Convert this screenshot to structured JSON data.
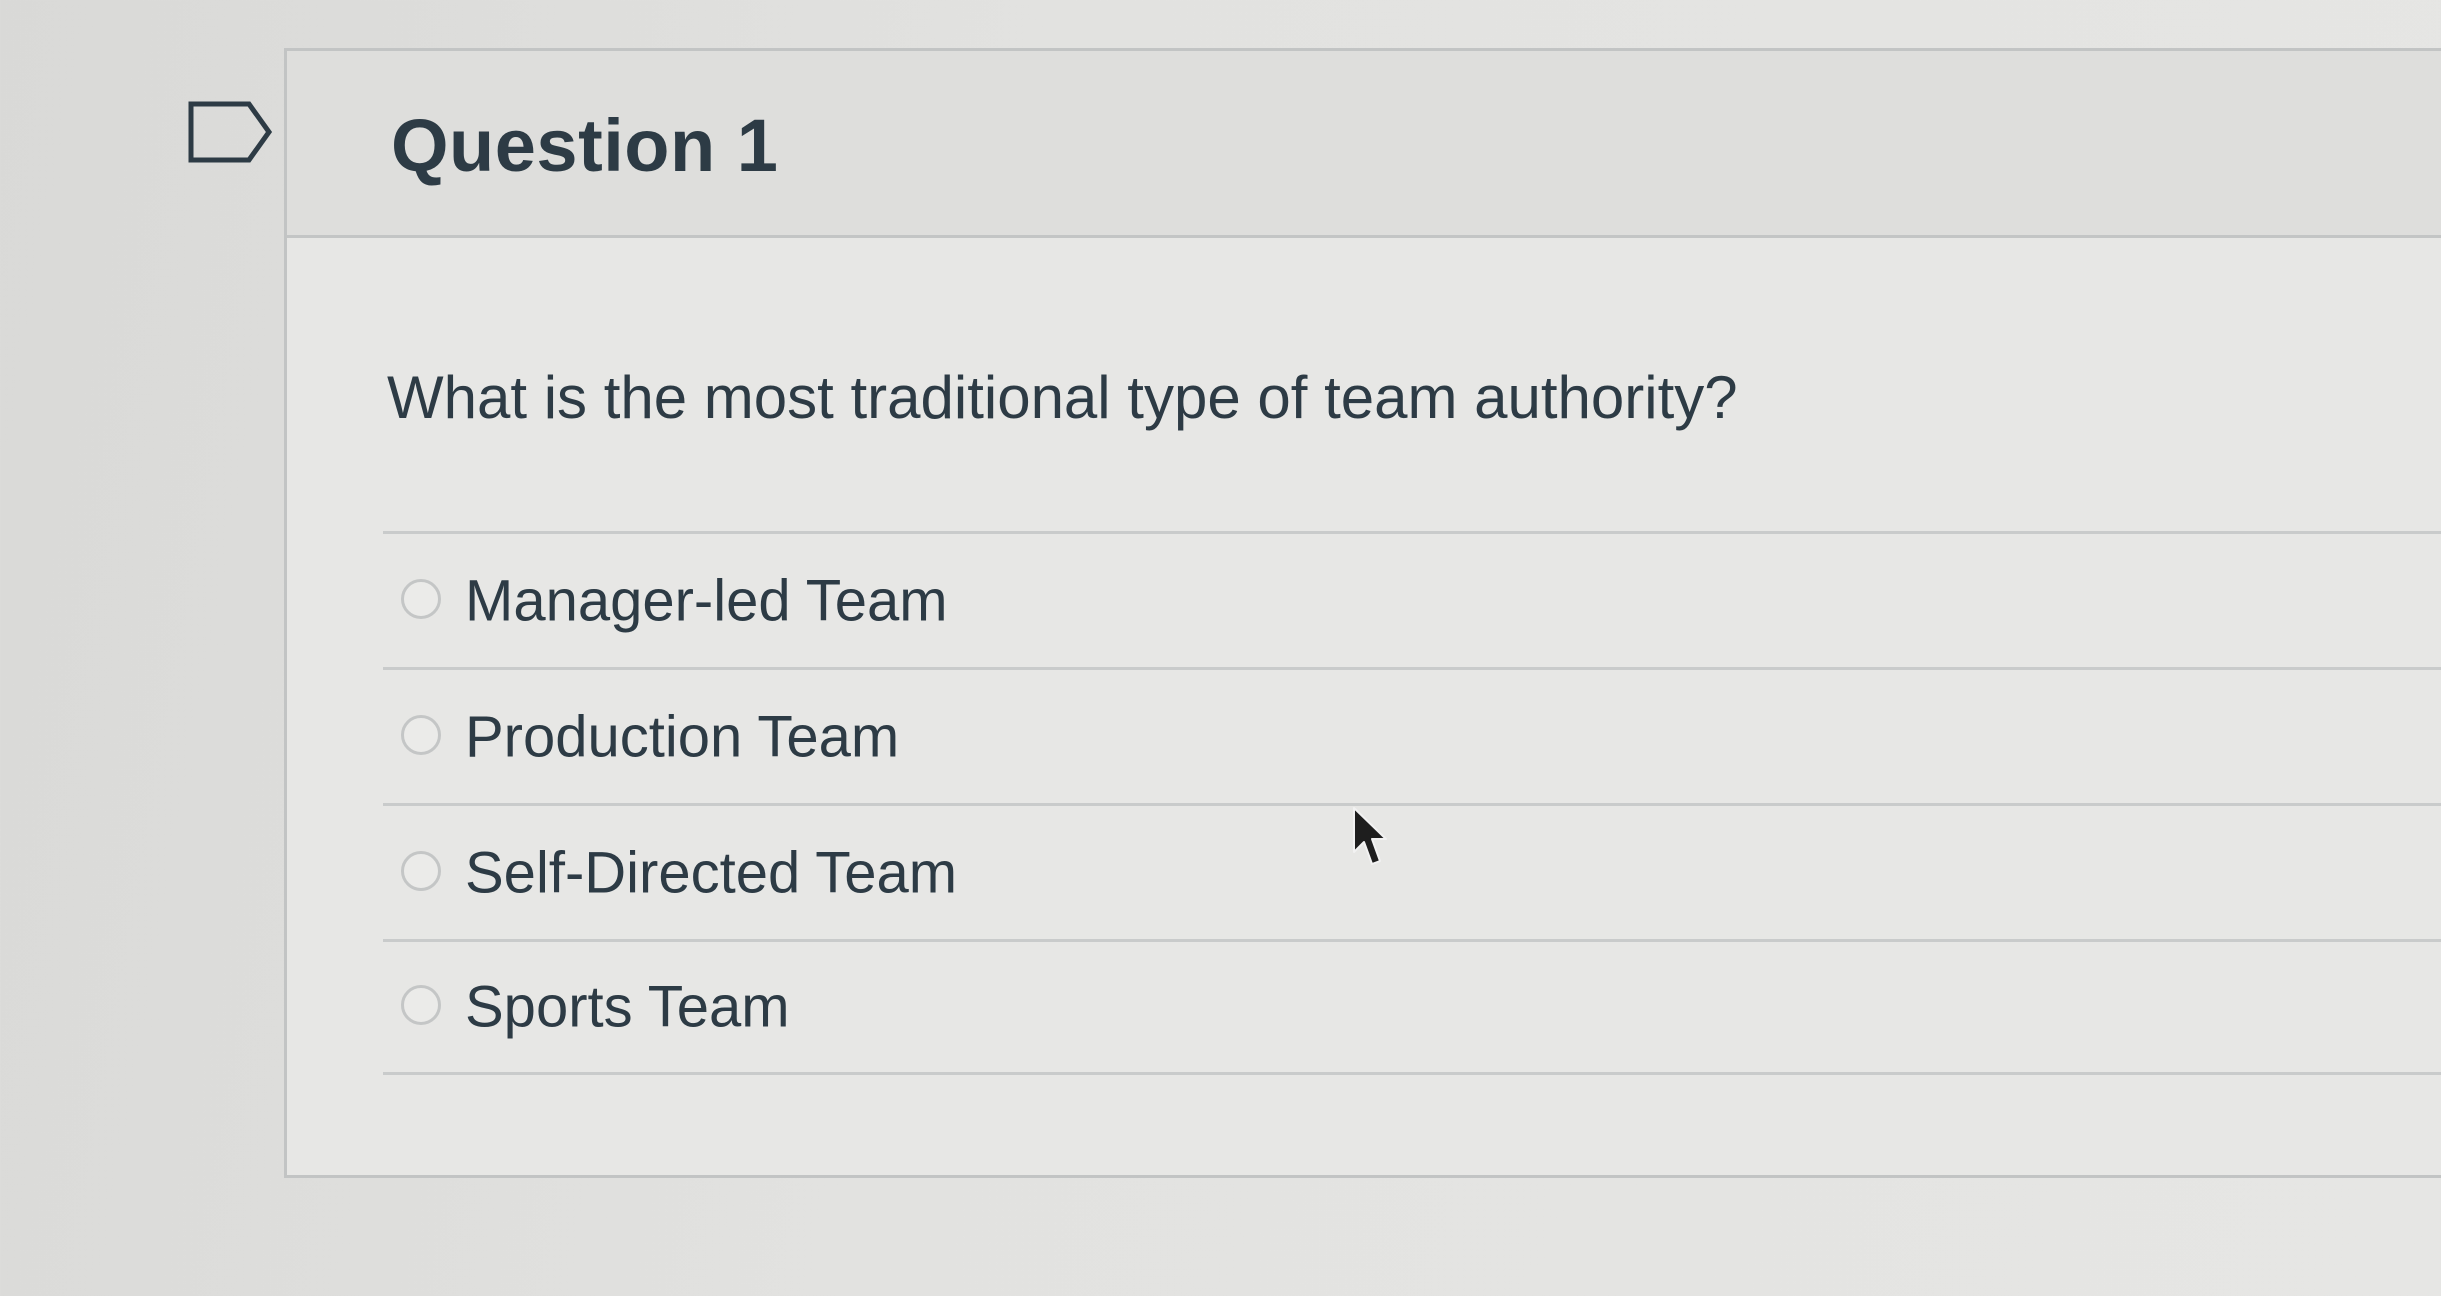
{
  "question": {
    "title": "Question 1",
    "text": "What is the most traditional type of team authority?",
    "answers": [
      {
        "label": "Manager-led Team",
        "selected": false
      },
      {
        "label": "Production Team",
        "selected": false
      },
      {
        "label": "Self-Directed Team",
        "selected": false
      },
      {
        "label": "Sports Team",
        "selected": false
      }
    ]
  },
  "icons": {
    "flag": "flag-question-icon",
    "cursor": "mouse-pointer-icon"
  },
  "colors": {
    "text": "#2d3b45",
    "border": "#c2c4c4",
    "background": "#e7e7e5"
  }
}
